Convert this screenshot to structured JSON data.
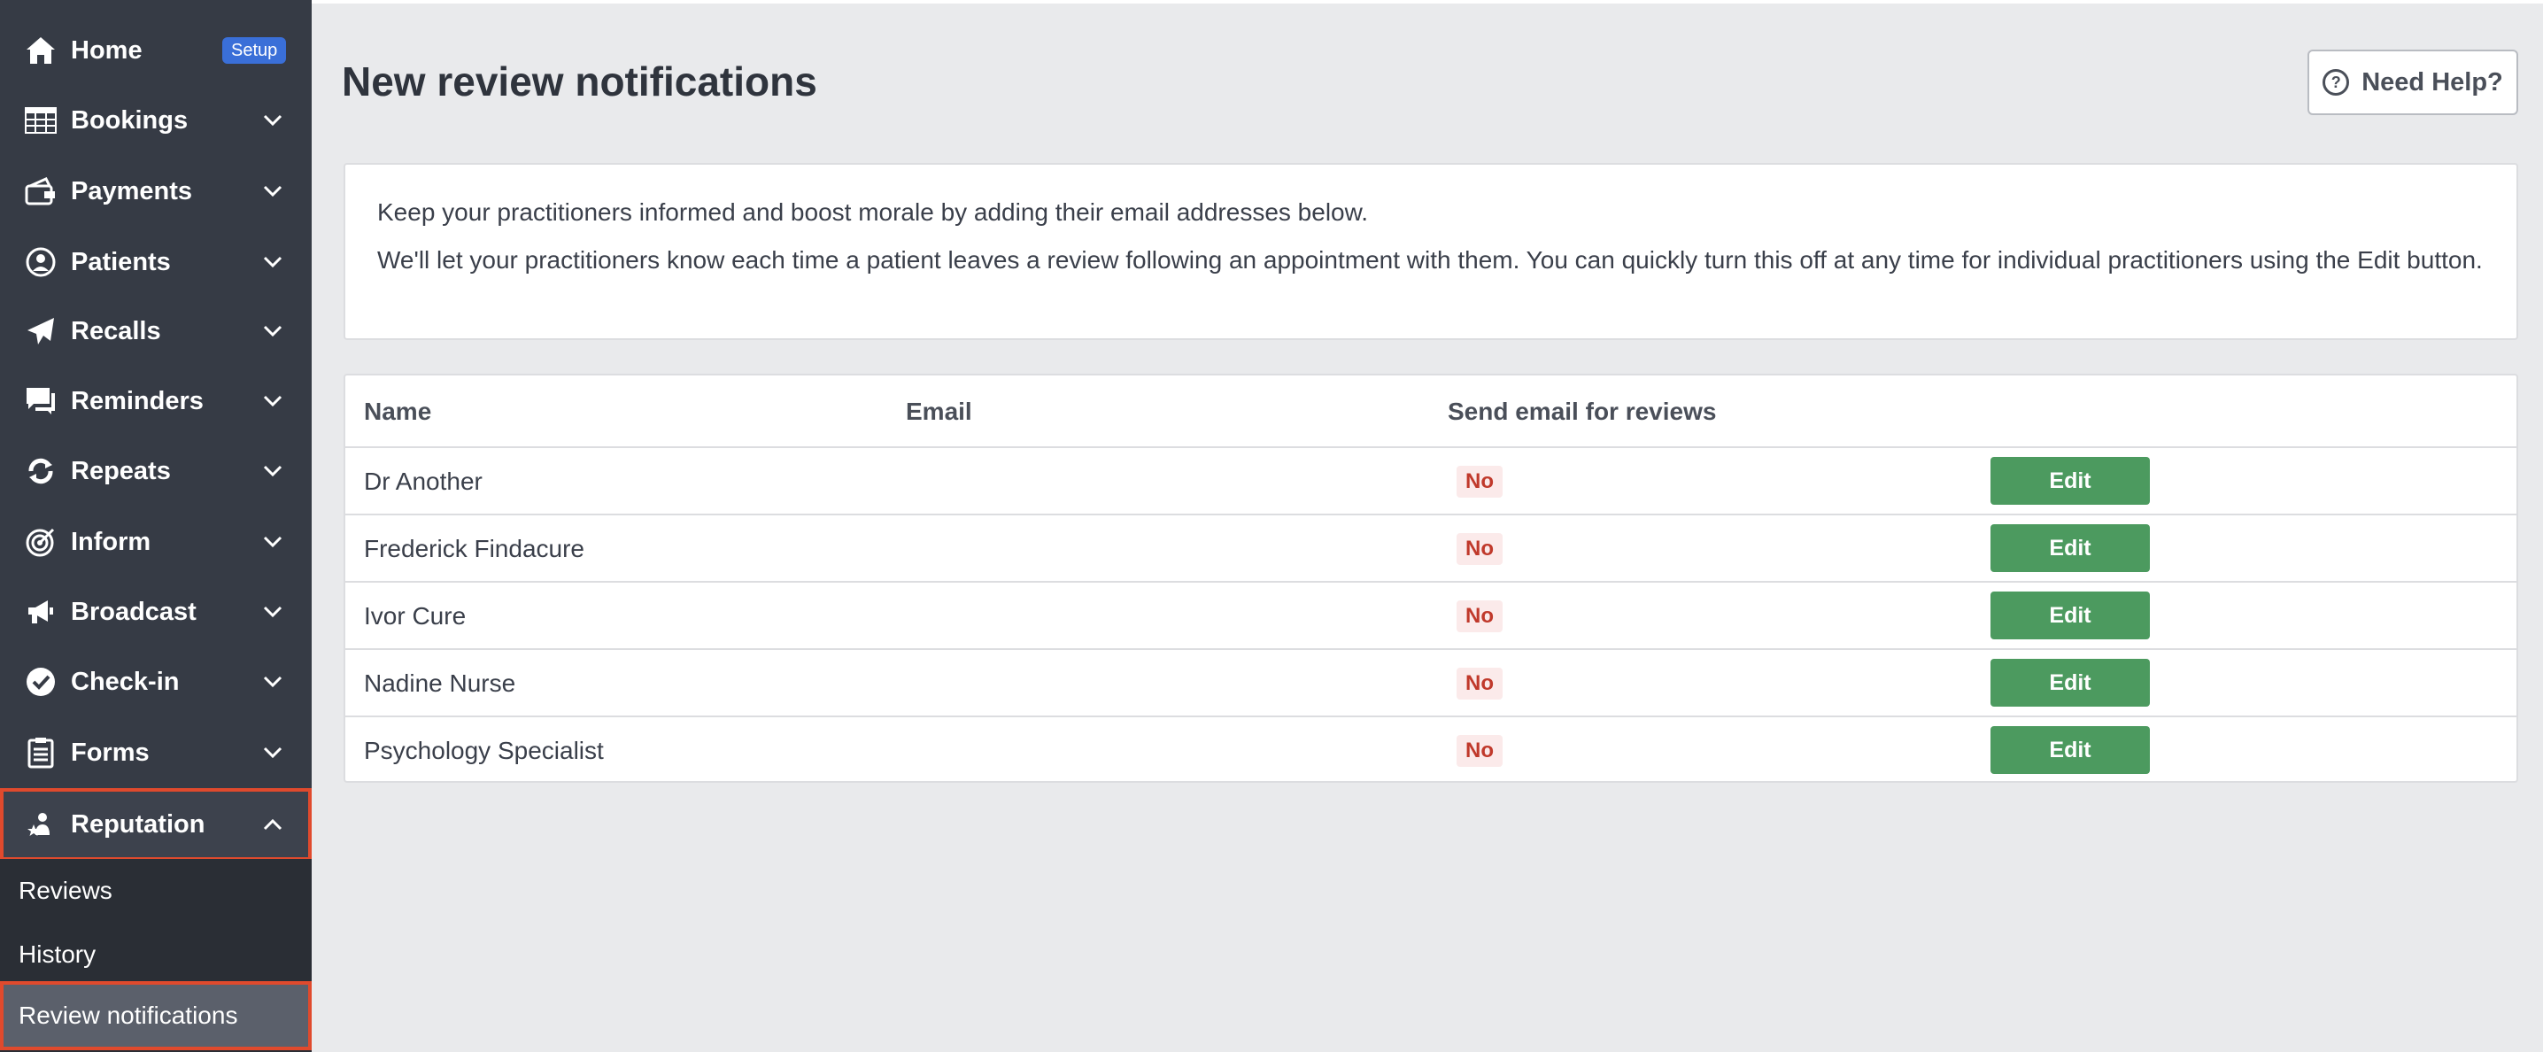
{
  "sidebar": {
    "items": [
      {
        "label": "Home",
        "icon": "home-icon",
        "badge": "Setup"
      },
      {
        "label": "Bookings",
        "icon": "table-icon"
      },
      {
        "label": "Payments",
        "icon": "payment-icon"
      },
      {
        "label": "Patients",
        "icon": "user-circle-icon"
      },
      {
        "label": "Recalls",
        "icon": "paper-plane-icon"
      },
      {
        "label": "Reminders",
        "icon": "chat-icon"
      },
      {
        "label": "Repeats",
        "icon": "repeat-icon"
      },
      {
        "label": "Inform",
        "icon": "target-icon"
      },
      {
        "label": "Broadcast",
        "icon": "megaphone-icon"
      },
      {
        "label": "Check-in",
        "icon": "check-badge-icon"
      },
      {
        "label": "Forms",
        "icon": "clipboard-icon"
      },
      {
        "label": "Reputation",
        "icon": "reputation-icon"
      }
    ],
    "sub_items": [
      {
        "label": "Reviews"
      },
      {
        "label": "History"
      },
      {
        "label": "Review notifications"
      }
    ]
  },
  "main": {
    "title": "New review notifications",
    "help_label": "Need Help?",
    "info": {
      "line1": "Keep your practitioners informed and boost morale by adding their email addresses below.",
      "line2": "We'll let your practitioners know each time a patient leaves a review following an appointment with them. You can quickly turn this off at any time for individual practitioners using the Edit button."
    },
    "table": {
      "headers": [
        "Name",
        "Email",
        "Send email for reviews"
      ],
      "rows": [
        {
          "name": "Dr Another",
          "email": "",
          "send": "No",
          "action": "Edit"
        },
        {
          "name": "Frederick Findacure",
          "email": "",
          "send": "No",
          "action": "Edit"
        },
        {
          "name": "Ivor Cure",
          "email": "",
          "send": "No",
          "action": "Edit"
        },
        {
          "name": "Nadine Nurse",
          "email": "",
          "send": "No",
          "action": "Edit"
        },
        {
          "name": "Psychology Specialist",
          "email": "",
          "send": "No",
          "action": "Edit"
        }
      ]
    }
  },
  "colors": {
    "sidebar_bg": "#363b45",
    "highlight_border": "#e04a2d",
    "edit_button": "#4c9a5f",
    "no_badge_text": "#c0392b",
    "setup_badge": "#3a6fd8"
  }
}
